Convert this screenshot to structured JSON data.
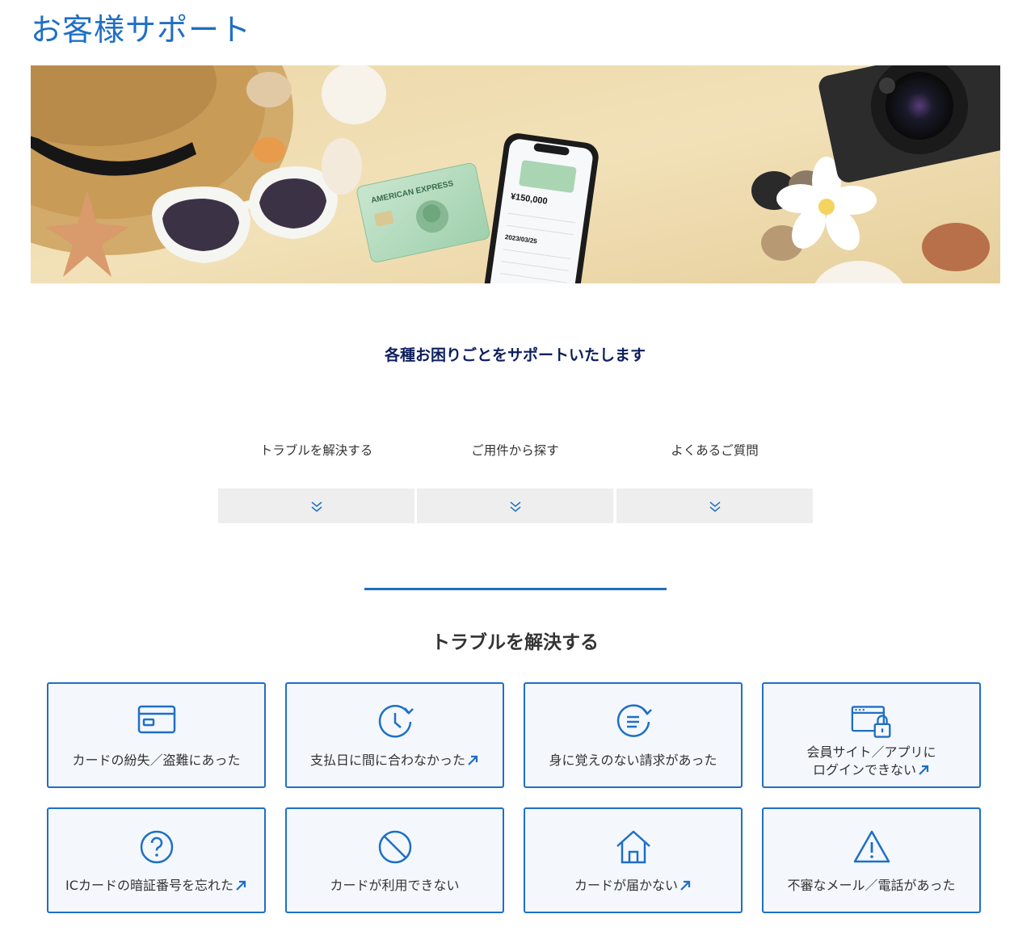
{
  "page": {
    "title": "お客様サポート"
  },
  "lead": "各種お困りごとをサポートいたします",
  "anchors": [
    {
      "label": "トラブルを解決する",
      "icon": "double-chevron-down-icon"
    },
    {
      "label": "ご用件から探す",
      "icon": "double-chevron-down-icon"
    },
    {
      "label": "よくあるご質問",
      "icon": "double-chevron-down-icon"
    }
  ],
  "section": {
    "title": "トラブルを解決する"
  },
  "tiles": [
    {
      "label": "カードの紛失／盗難にあった",
      "icon": "card-icon",
      "external": false
    },
    {
      "label": "支払日に間に合わなかった",
      "icon": "clock-icon",
      "external": true
    },
    {
      "label": "身に覚えのない請求があった",
      "icon": "billing-refresh-icon",
      "external": false
    },
    {
      "line1": "会員サイト／アプリに",
      "line2": "ログインできない",
      "icon": "browser-lock-icon",
      "external": true
    },
    {
      "label": "ICカードの暗証番号を忘れた",
      "icon": "question-icon",
      "external": true
    },
    {
      "label": "カードが利用できない",
      "icon": "prohibited-icon",
      "external": false
    },
    {
      "label": "カードが届かない",
      "icon": "home-icon",
      "external": true
    },
    {
      "label": "不審なメール／電話があった",
      "icon": "warning-icon",
      "external": false
    }
  ],
  "hero": {
    "card_brand": "AMERICAN EXPRESS",
    "phone_amount": "¥150,000",
    "phone_date": "2023/03/25"
  },
  "colors": {
    "brand": "#1f6fc5",
    "lead": "#0d1f5c",
    "tile_bg": "#f4f8fd",
    "anchor_bg": "#eeeeee"
  }
}
